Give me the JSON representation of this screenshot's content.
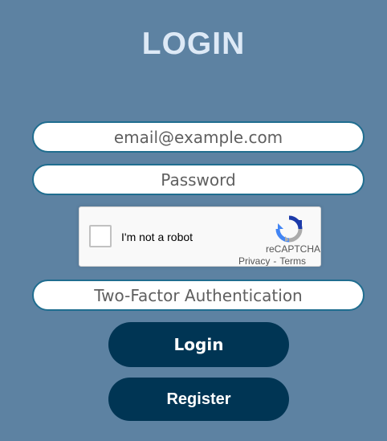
{
  "page": {
    "title": "LOGIN"
  },
  "form": {
    "email": {
      "placeholder": "email@example.com",
      "value": ""
    },
    "password": {
      "placeholder": "Password",
      "value": ""
    },
    "two_factor": {
      "placeholder": "Two-Factor Authentication",
      "value": ""
    },
    "login_label": "Login",
    "register_label": "Register"
  },
  "captcha": {
    "label": "I'm not a robot",
    "checked": false,
    "brand": "reCAPTCHA",
    "privacy_link": "Privacy",
    "separator": "-",
    "terms_link": "Terms",
    "logo_icon": "recaptcha-logo-icon"
  },
  "colors": {
    "background": "#5d82a2",
    "title": "#dde9f6",
    "field_border": "#1f6d8f",
    "button": "#003554",
    "button_text": "#ffffff"
  }
}
